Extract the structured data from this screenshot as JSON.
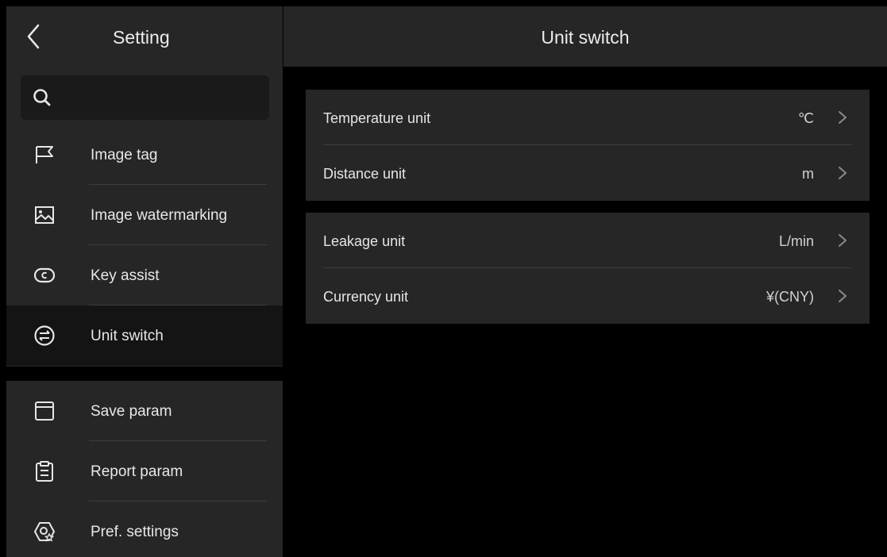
{
  "sidebar": {
    "title": "Setting",
    "search": {
      "placeholder": ""
    },
    "items": [
      {
        "label": "Image tag",
        "icon": "flag-icon"
      },
      {
        "label": "Image watermarking",
        "icon": "image-icon"
      },
      {
        "label": "Key assist",
        "icon": "key-assist-icon"
      },
      {
        "label": "Unit switch",
        "icon": "unit-switch-icon",
        "active": true
      },
      {
        "label": "Save param",
        "icon": "save-icon"
      },
      {
        "label": "Report param",
        "icon": "clipboard-icon"
      },
      {
        "label": "Pref. settings",
        "icon": "preference-icon"
      }
    ]
  },
  "main": {
    "title": "Unit switch",
    "groups": [
      {
        "rows": [
          {
            "label": "Temperature unit",
            "value": "℃"
          },
          {
            "label": "Distance unit",
            "value": "m"
          }
        ]
      },
      {
        "rows": [
          {
            "label": "Leakage unit",
            "value": "L/min"
          },
          {
            "label": "Currency unit",
            "value": "¥(CNY)"
          }
        ]
      }
    ]
  },
  "colors": {
    "accent": "#3f8ff2",
    "panel": "#262626",
    "background": "#000000",
    "active_item": "#141414"
  }
}
